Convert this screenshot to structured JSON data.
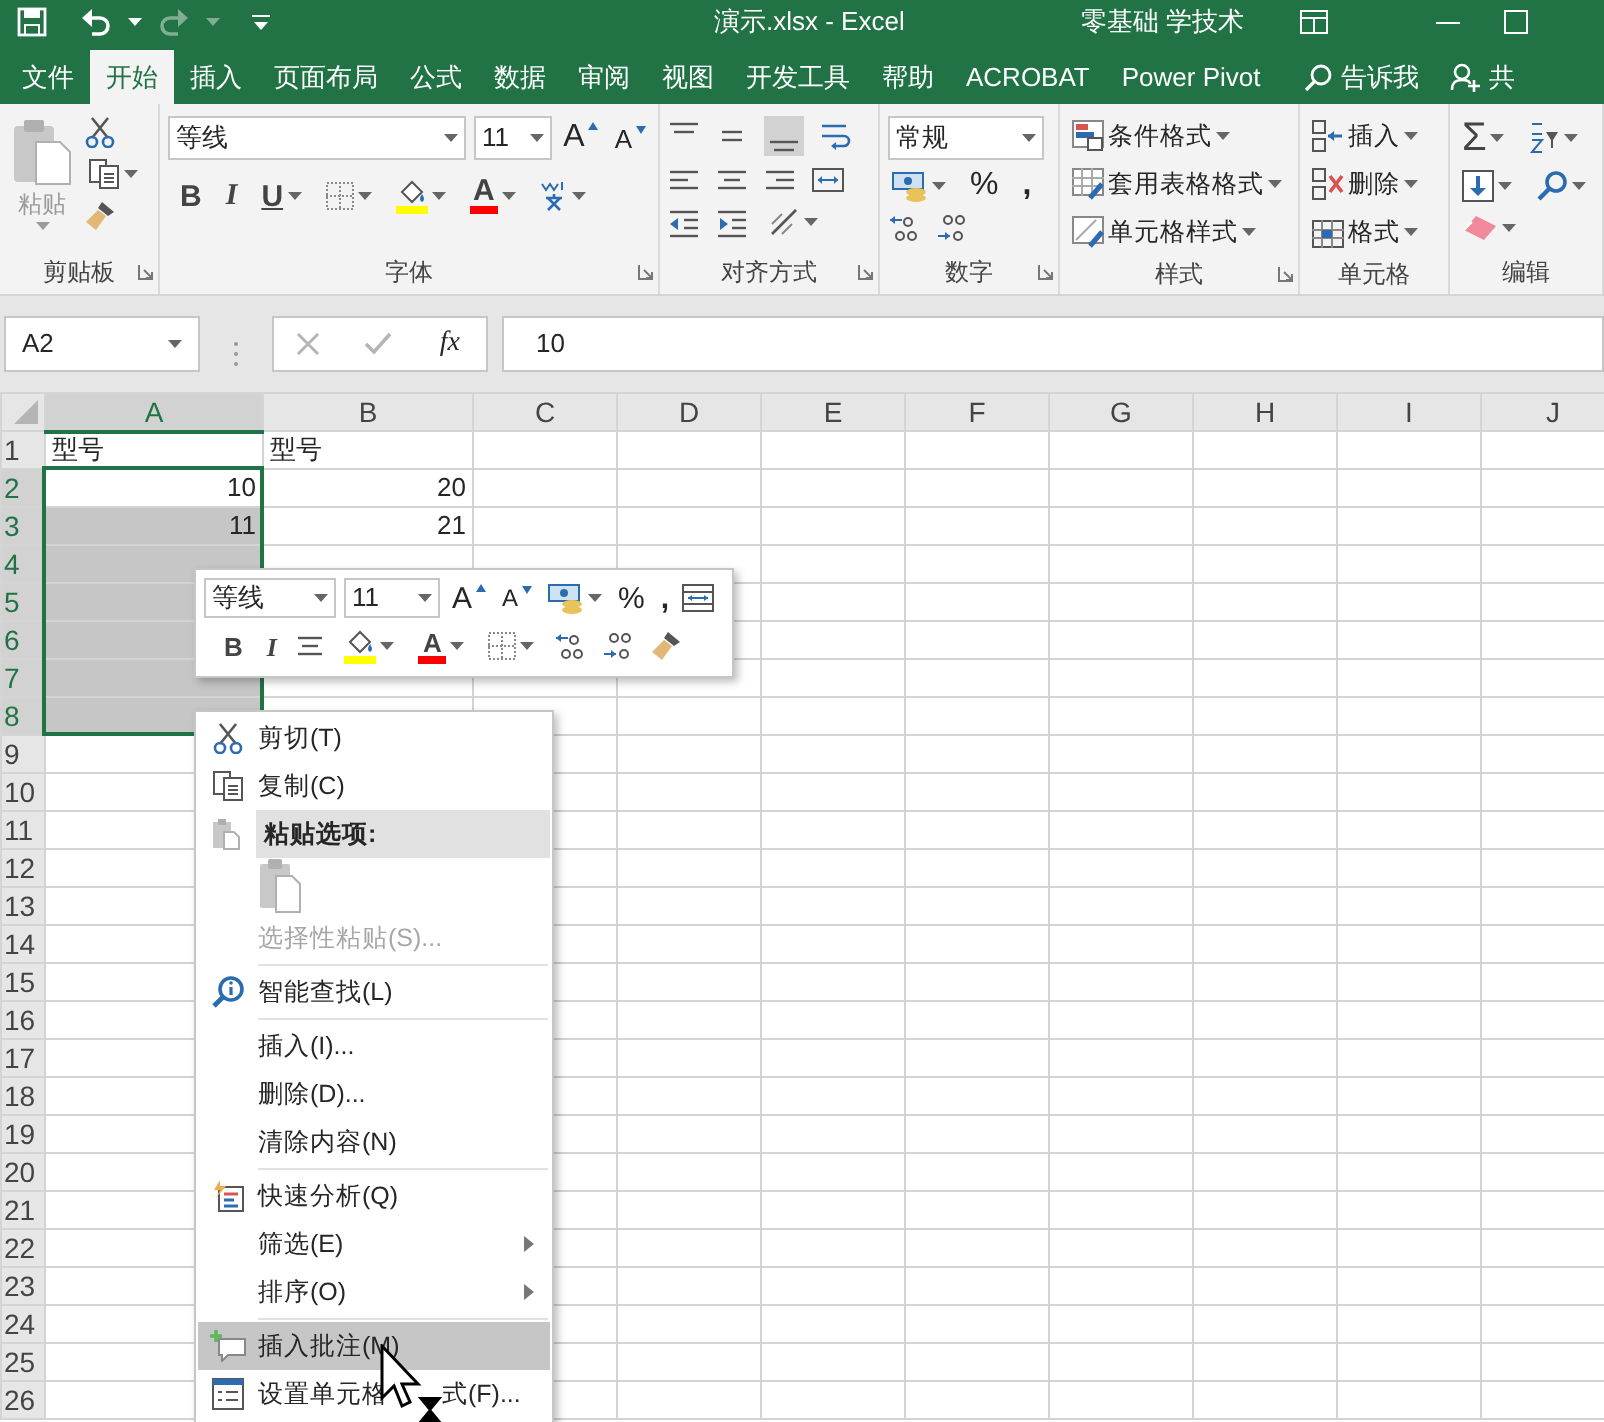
{
  "title_bar": {
    "title": "演示.xlsx  -  Excel",
    "account": "零基础 学技术"
  },
  "tabs": [
    {
      "label": "文件",
      "selected": false
    },
    {
      "label": "开始",
      "selected": true
    },
    {
      "label": "插入",
      "selected": false
    },
    {
      "label": "页面布局",
      "selected": false
    },
    {
      "label": "公式",
      "selected": false
    },
    {
      "label": "数据",
      "selected": false
    },
    {
      "label": "审阅",
      "selected": false
    },
    {
      "label": "视图",
      "selected": false
    },
    {
      "label": "开发工具",
      "selected": false
    },
    {
      "label": "帮助",
      "selected": false
    },
    {
      "label": "ACROBAT",
      "selected": false
    },
    {
      "label": "Power Pivot",
      "selected": false
    }
  ],
  "tell_me": "告诉我",
  "share": "共",
  "ribbon": {
    "clipboard": {
      "paste": "粘贴",
      "label": "剪贴板"
    },
    "font": {
      "font_name": "等线",
      "font_size": "11",
      "grow": "A",
      "shrink": "A",
      "bold": "B",
      "italic": "I",
      "underline": "U",
      "font_color": "A",
      "label": "字体"
    },
    "alignment": {
      "label": "对齐方式"
    },
    "number": {
      "format": "常规",
      "percent": "%",
      "comma": ",",
      "label": "数字"
    },
    "styles": {
      "buttons": [
        "条件格式",
        "套用表格格式",
        "单元格样式"
      ],
      "label": "样式"
    },
    "cells": {
      "buttons": [
        "插入",
        "删除",
        "格式"
      ],
      "label": "单元格"
    },
    "editing": {
      "autosum": "Σ",
      "label": "编辑"
    }
  },
  "formula_bar": {
    "name_box": "A2",
    "insert_function": "fx",
    "formula": "10"
  },
  "columns": [
    {
      "label": "A",
      "selected": true
    },
    {
      "label": "B",
      "selected": false
    },
    {
      "label": "C",
      "selected": false
    },
    {
      "label": "D",
      "selected": false
    },
    {
      "label": "E",
      "selected": false
    },
    {
      "label": "F",
      "selected": false
    },
    {
      "label": "G",
      "selected": false
    },
    {
      "label": "H",
      "selected": false
    },
    {
      "label": "I",
      "selected": false
    },
    {
      "label": "J",
      "selected": false
    }
  ],
  "rows": [
    {
      "header": "1",
      "selected": false,
      "cells": [
        {
          "text": "型号",
          "kind": "text",
          "selected": false
        },
        {
          "text": "型号",
          "kind": "text",
          "selected": false
        }
      ]
    },
    {
      "header": "2",
      "selected": true,
      "cells": [
        {
          "text": "10",
          "kind": "number",
          "selected": true,
          "active": true
        },
        {
          "text": "20",
          "kind": "number",
          "selected": false
        }
      ]
    },
    {
      "header": "3",
      "selected": true,
      "cells": [
        {
          "text": "11",
          "kind": "number",
          "selected": true,
          "active": false
        },
        {
          "text": "21",
          "kind": "number",
          "selected": false
        }
      ]
    },
    {
      "header": "4",
      "selected": true,
      "cells": [
        {
          "selected": true,
          "active": false
        }
      ]
    },
    {
      "header": "5",
      "selected": true,
      "cells": [
        {
          "selected": true,
          "active": false
        }
      ]
    },
    {
      "header": "6",
      "selected": true,
      "cells": [
        {
          "selected": true,
          "active": false
        }
      ]
    },
    {
      "header": "7",
      "selected": true,
      "cells": [
        {
          "selected": true,
          "active": false
        }
      ]
    },
    {
      "header": "8",
      "selected": true,
      "cells": [
        {
          "selected": true,
          "active": false
        }
      ]
    },
    {
      "header": "9",
      "selected": false
    },
    {
      "header": "10",
      "selected": false
    },
    {
      "header": "11",
      "selected": false
    },
    {
      "header": "12",
      "selected": false
    },
    {
      "header": "13",
      "selected": false
    },
    {
      "header": "14",
      "selected": false
    },
    {
      "header": "15",
      "selected": false
    },
    {
      "header": "16",
      "selected": false
    },
    {
      "header": "17",
      "selected": false
    },
    {
      "header": "18",
      "selected": false
    },
    {
      "header": "19",
      "selected": false
    },
    {
      "header": "20",
      "selected": false
    },
    {
      "header": "21",
      "selected": false
    },
    {
      "header": "22",
      "selected": false
    },
    {
      "header": "23",
      "selected": false
    },
    {
      "header": "24",
      "selected": false
    },
    {
      "header": "25",
      "selected": false
    },
    {
      "header": "26",
      "selected": false
    }
  ],
  "mini_toolbar": {
    "font_name": "等线",
    "font_size": "11",
    "grow": "A",
    "shrink": "A",
    "percent": "%",
    "comma": ",",
    "bold": "B",
    "italic": "I",
    "font_color": "A"
  },
  "context_menu": [
    {
      "kind": "item",
      "label": "剪切(T)",
      "disabled": false,
      "selected": false,
      "submenu": false
    },
    {
      "kind": "item",
      "label": "复制(C)",
      "disabled": false,
      "selected": false,
      "submenu": false
    },
    {
      "kind": "header",
      "label": "粘贴选项:"
    },
    {
      "kind": "paste_options",
      "selected": false
    },
    {
      "kind": "item",
      "label": "选择性粘贴(S)...",
      "disabled": true,
      "selected": false,
      "submenu": false
    },
    {
      "kind": "item",
      "label": "智能查找(L)",
      "disabled": false,
      "selected": false,
      "submenu": false,
      "separator_before": true
    },
    {
      "kind": "item",
      "label": "插入(I)...",
      "disabled": false,
      "selected": false,
      "submenu": false,
      "separator_before": true
    },
    {
      "kind": "item",
      "label": "删除(D)...",
      "disabled": false,
      "selected": false,
      "submenu": false
    },
    {
      "kind": "item",
      "label": "清除内容(N)",
      "disabled": false,
      "selected": false,
      "submenu": false
    },
    {
      "kind": "item",
      "label": "快速分析(Q)",
      "disabled": false,
      "selected": false,
      "submenu": false,
      "separator_before": true
    },
    {
      "kind": "item",
      "label": "筛选(E)",
      "disabled": false,
      "selected": false,
      "submenu": true
    },
    {
      "kind": "item",
      "label": "排序(O)",
      "disabled": false,
      "selected": false,
      "submenu": true
    },
    {
      "kind": "item",
      "label": "插入批注(M)",
      "disabled": false,
      "selected": true,
      "submenu": false,
      "separator_before": true
    },
    {
      "kind": "item",
      "label": "设置单元格",
      "label_tail": "式(F)...",
      "disabled": false,
      "selected": false,
      "submenu": false
    }
  ]
}
